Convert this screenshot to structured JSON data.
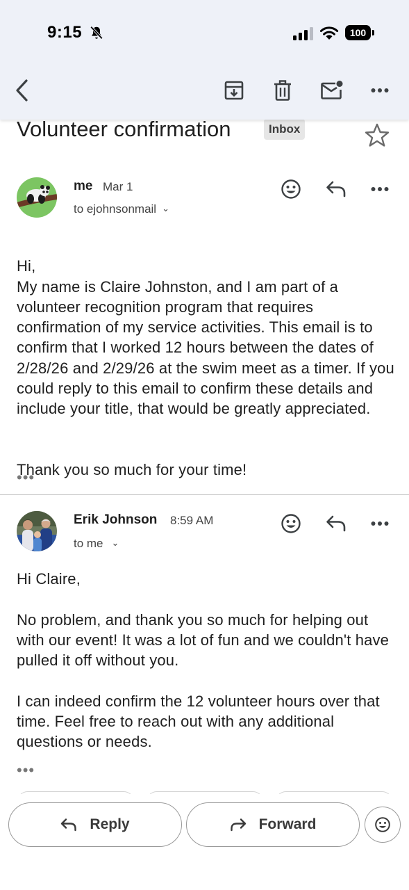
{
  "status_bar": {
    "time": "9:15",
    "battery": "100"
  },
  "email": {
    "subject": "Volunteer confirmation",
    "label": "Inbox"
  },
  "messages": [
    {
      "sender": "me",
      "date": "Mar 1",
      "recipient": "to ejohnsonmail",
      "paragraphs": [
        "Hi,\nMy name is Claire Johnston, and I am part of a volunteer recognition program that requires confirmation of my service activities. This email is to confirm that I worked 12 hours between the dates of 2/28/26 and 2/29/26 at the swim meet as a timer. If you could reply to this email to confirm these details and include your title, that would be greatly appreciated.",
        "Thank you so much for your time!"
      ],
      "quoted_toggle": "•••"
    },
    {
      "sender": "Erik Johnson",
      "date": "8:59 AM",
      "recipient": "to me",
      "paragraphs": [
        "Hi Claire,",
        "No problem, and thank you so much for helping out with our event!  It was a lot of fun and we couldn't have pulled it off without you.",
        "I can indeed confirm the 12 volunteer hours over that time.  Feel free to reach out with any additional questions or needs."
      ],
      "quoted_toggle": "•••"
    }
  ],
  "actions": {
    "reply_label": "Reply",
    "forward_label": "Forward"
  },
  "icons": {
    "back": "chevron-left-icon",
    "archive": "archive-icon",
    "delete": "trash-icon",
    "mark_unread": "mail-unread-icon",
    "more": "more-horizontal-icon",
    "star": "star-icon",
    "emoji": "emoji-icon",
    "reply": "reply-icon",
    "forward": "forward-icon"
  },
  "colors": {
    "toolbar_bg": "#eef1f8",
    "icon": "#3c4043",
    "label_chip_bg": "#e6e6e6"
  }
}
